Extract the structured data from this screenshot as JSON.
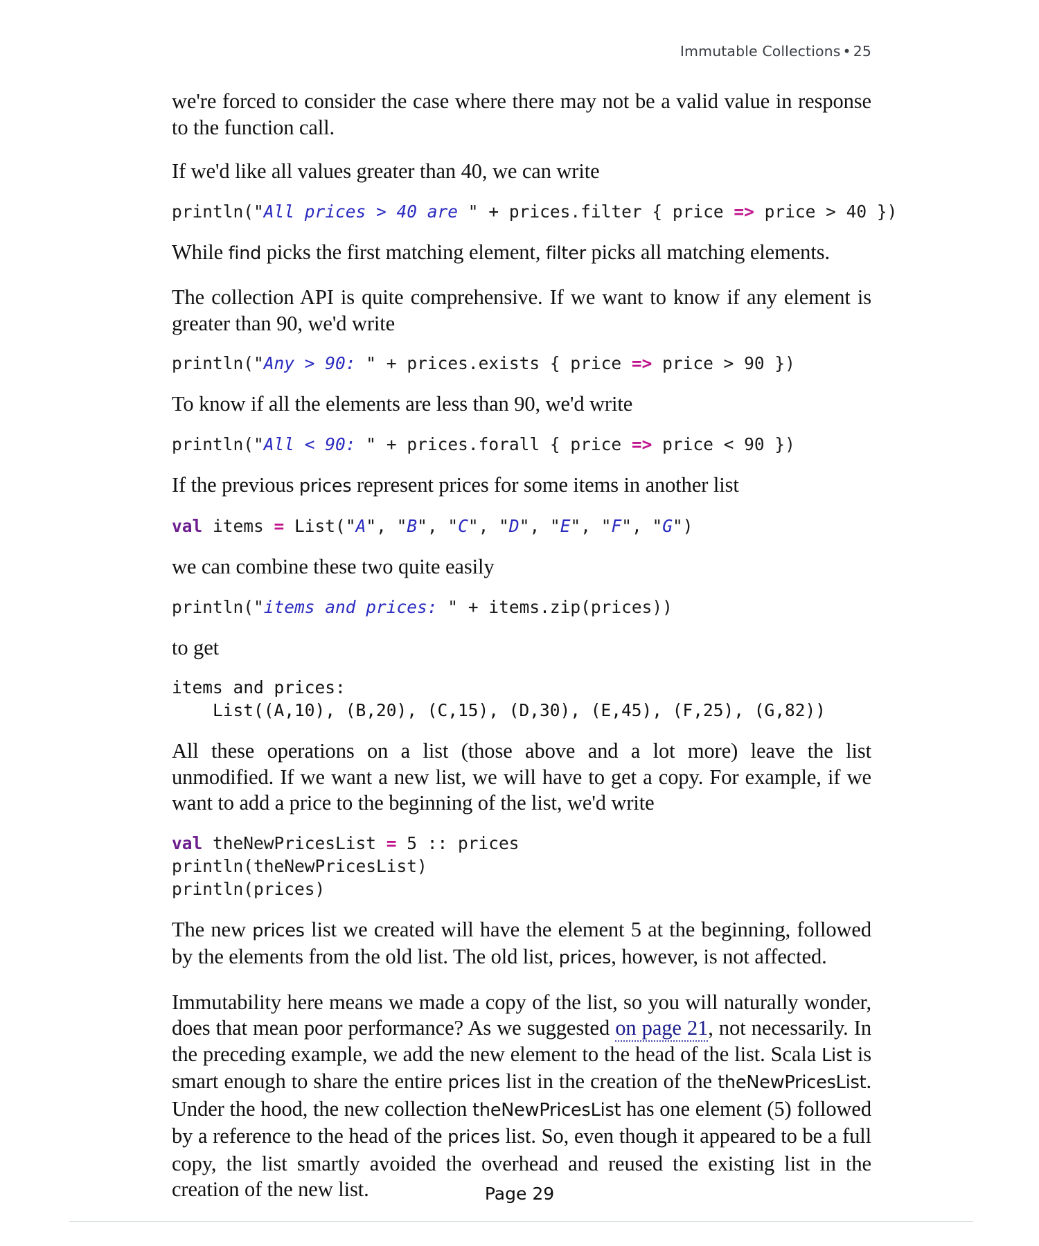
{
  "header": {
    "chapter_title": "Immutable Collections",
    "separator": "•",
    "page_number": "25"
  },
  "footer": {
    "page_label": "Page 29"
  },
  "colors": {
    "keyword": "#6d1f8f",
    "operator": "#c0158c",
    "string": "#2a2ac0",
    "link": "#1c1c8c",
    "header_text": "#3a3f45",
    "rule": "#d6dcdc"
  },
  "body": {
    "p1": "we're forced to consider the case where there may not be a valid value in response to the function call.",
    "p2": "If we'd like all values greater than 40, we can write",
    "code1": {
      "segments": [
        {
          "text": "println(",
          "style": "plain"
        },
        {
          "text": "\"",
          "style": "plain"
        },
        {
          "text": "All prices > 40 are ",
          "style": "str"
        },
        {
          "text": "\"",
          "style": "plain"
        },
        {
          "text": " + prices.filter { price ",
          "style": "plain"
        },
        {
          "text": "=>",
          "style": "op"
        },
        {
          "text": " price > 40 })",
          "style": "plain"
        }
      ]
    },
    "p3_a": "While ",
    "p3_code1": "find",
    "p3_b": " picks the first matching element, ",
    "p3_code2": "filter",
    "p3_c": " picks all matching elements.",
    "p4": "The collection API is quite comprehensive. If we want to know if any element is greater than 90, we'd write",
    "code2": {
      "segments": [
        {
          "text": "println(",
          "style": "plain"
        },
        {
          "text": "\"",
          "style": "plain"
        },
        {
          "text": "Any > 90: ",
          "style": "str"
        },
        {
          "text": "\"",
          "style": "plain"
        },
        {
          "text": " + prices.exists { price ",
          "style": "plain"
        },
        {
          "text": "=>",
          "style": "op"
        },
        {
          "text": " price > 90 })",
          "style": "plain"
        }
      ]
    },
    "p5": "To know if all the elements are less than 90, we'd write",
    "code3": {
      "segments": [
        {
          "text": "println(",
          "style": "plain"
        },
        {
          "text": "\"",
          "style": "plain"
        },
        {
          "text": "All < 90: ",
          "style": "str"
        },
        {
          "text": "\"",
          "style": "plain"
        },
        {
          "text": " + prices.forall { price ",
          "style": "plain"
        },
        {
          "text": "=>",
          "style": "op"
        },
        {
          "text": " price < 90 })",
          "style": "plain"
        }
      ]
    },
    "p6_a": "If the previous ",
    "p6_code": "prices",
    "p6_b": " represent prices for some items in another list",
    "code4": {
      "segments": [
        {
          "text": "val",
          "style": "kw"
        },
        {
          "text": " items ",
          "style": "plain"
        },
        {
          "text": "=",
          "style": "op"
        },
        {
          "text": " List(",
          "style": "plain"
        },
        {
          "text": "\"",
          "style": "plain"
        },
        {
          "text": "A",
          "style": "str"
        },
        {
          "text": "\", \"",
          "style": "plain"
        },
        {
          "text": "B",
          "style": "str"
        },
        {
          "text": "\", \"",
          "style": "plain"
        },
        {
          "text": "C",
          "style": "str"
        },
        {
          "text": "\", \"",
          "style": "plain"
        },
        {
          "text": "D",
          "style": "str"
        },
        {
          "text": "\", \"",
          "style": "plain"
        },
        {
          "text": "E",
          "style": "str"
        },
        {
          "text": "\", \"",
          "style": "plain"
        },
        {
          "text": "F",
          "style": "str"
        },
        {
          "text": "\", \"",
          "style": "plain"
        },
        {
          "text": "G",
          "style": "str"
        },
        {
          "text": "\")",
          "style": "plain"
        }
      ]
    },
    "p7": "we can combine these two quite easily",
    "code5": {
      "segments": [
        {
          "text": "println(",
          "style": "plain"
        },
        {
          "text": "\"",
          "style": "plain"
        },
        {
          "text": "items and prices: ",
          "style": "str"
        },
        {
          "text": "\"",
          "style": "plain"
        },
        {
          "text": " + items.zip(prices))",
          "style": "plain"
        }
      ]
    },
    "p8": "to get",
    "output1": "items and prices:\n    List((A,10), (B,20), (C,15), (D,30), (E,45), (F,25), (G,82))",
    "p9": "All these operations on a list (those above and a lot more) leave the list unmodified. If we want a new list, we will have to get a copy. For example, if we want to add a price to the beginning of the list, we'd write",
    "code6_line1": {
      "segments": [
        {
          "text": "val",
          "style": "kw"
        },
        {
          "text": " theNewPricesList ",
          "style": "plain"
        },
        {
          "text": "=",
          "style": "op"
        },
        {
          "text": " 5 :: prices",
          "style": "plain"
        }
      ]
    },
    "code6_line2": "println(theNewPricesList)",
    "code6_line3": "println(prices)",
    "p10_a": "The new ",
    "p10_code1": "prices",
    "p10_b": " list we created will have the element 5 at the beginning, followed by the elements from the old list. The old list, ",
    "p10_code2": "prices",
    "p10_c": ", however, is not affected.",
    "p11_a": "Immutability here means we made a copy of the list, so you will naturally wonder, does that mean poor performance? As we suggested ",
    "p11_link": "on page 21",
    "p11_b": ", not necessarily. In the preceding example, we add the new element to the head of the list. Scala ",
    "p11_code1": "List",
    "p11_c": " is smart enough to share the entire ",
    "p11_code2": "prices",
    "p11_d": " list in the creation of the ",
    "p11_code3": "theNewPricesList",
    "p11_e": ". Under the hood, the new collection ",
    "p11_code4": "theNewPricesList",
    "p11_f": " has one element (5) followed by a reference to the head of the ",
    "p11_code5": "prices",
    "p11_g": " list. So, even though it appeared to be a full copy, the list smartly avoided the overhead and reused the existing list in the creation of the new list."
  }
}
